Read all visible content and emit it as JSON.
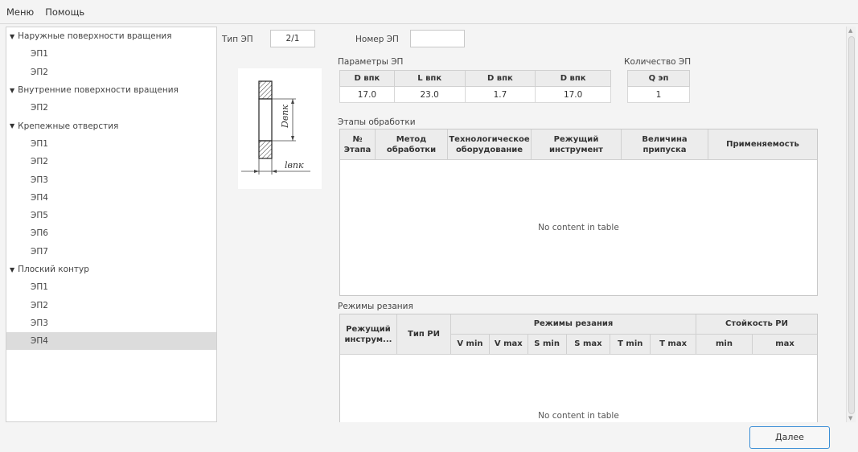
{
  "menubar": {
    "menu": "Меню",
    "help": "Помощь"
  },
  "tree": [
    {
      "label": "Наружные поверхности вращения",
      "items": [
        "ЭП1",
        "ЭП2"
      ]
    },
    {
      "label": "Внутренние поверхности вращения",
      "items": [
        "ЭП2"
      ]
    },
    {
      "label": "Крепежные отверстия",
      "items": [
        "ЭП1",
        "ЭП2",
        "ЭП3",
        "ЭП4",
        "ЭП5",
        "ЭП6",
        "ЭП7"
      ]
    },
    {
      "label": "Плоский контур",
      "items": [
        "ЭП1",
        "ЭП2",
        "ЭП3",
        "ЭП4"
      ]
    }
  ],
  "selected_tree_item": "Плоский контур / ЭП4",
  "form": {
    "type_label": "Тип ЭП",
    "type_value": "2/1",
    "number_label": "Номер ЭП",
    "number_value": "",
    "params_label": "Параметры ЭП",
    "qty_label": "Количество ЭП",
    "params_headers": [
      "D впк",
      "L впк",
      "D впк",
      "D впк"
    ],
    "params_values": [
      "17.0",
      "23.0",
      "1.7",
      "17.0"
    ],
    "qty_header": "Q эп",
    "qty_value": "1",
    "sketch_d_label": "Dвпк",
    "sketch_l_label": "lвпк"
  },
  "stages": {
    "label": "Этапы обработки",
    "headers": [
      "№ Этапа",
      "Метод обработки",
      "Технологическое оборудование",
      "Режущий инструмент",
      "Величина припуска",
      "Применяемость"
    ],
    "empty_text": "No content in table"
  },
  "cutting": {
    "label": "Режимы резания",
    "headers": {
      "tool": "Режущий инструм...",
      "type": "Тип РИ",
      "modes": "Режимы резания",
      "modes_sub": [
        "V min",
        "V max",
        "S min",
        "S max",
        "T min",
        "T max"
      ],
      "durability": "Стойкость РИ",
      "durability_sub": [
        "min",
        "max"
      ]
    },
    "empty_text": "No content in table"
  },
  "footer": {
    "next_label": "Далее"
  }
}
